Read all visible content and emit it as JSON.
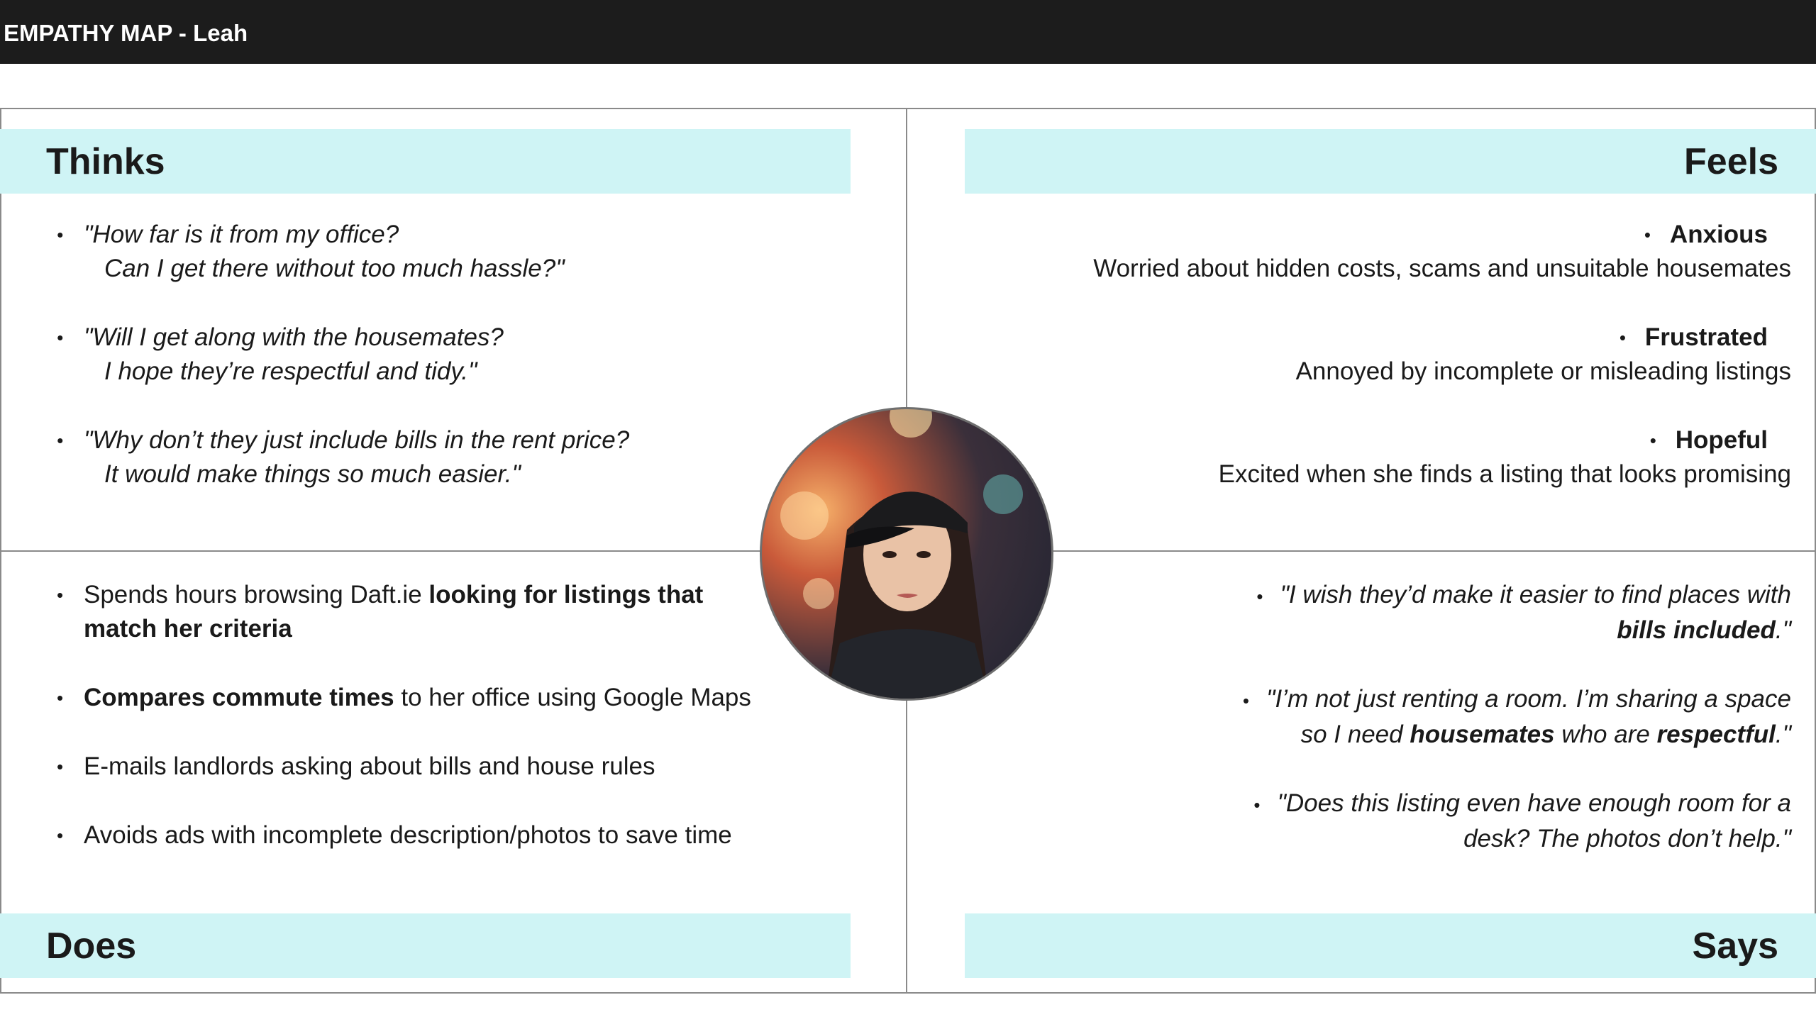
{
  "header": {
    "title": "EMPATHY MAP - Leah"
  },
  "quadrants": {
    "thinks": {
      "title": "Thinks",
      "items": [
        {
          "line1": "\"How far is it from my office?",
          "line2": "Can I get there without too much hassle?\""
        },
        {
          "line1": "\"Will I get along with the housemates?",
          "line2": "I hope they’re respectful and tidy.\""
        },
        {
          "line1": "\"Why don’t they just include bills in the rent price?",
          "line2": "It would make things so much easier.\""
        }
      ]
    },
    "feels": {
      "title": "Feels",
      "items": [
        {
          "emotion": "Anxious",
          "description": "Worried about hidden costs, scams and unsuitable housemates"
        },
        {
          "emotion": "Frustrated",
          "description": "Annoyed by incomplete or misleading listings"
        },
        {
          "emotion": "Hopeful",
          "description": "Excited when she finds a listing that looks promising"
        }
      ]
    },
    "does": {
      "title": "Does",
      "items": [
        {
          "pre": "Spends hours browsing Daft.ie ",
          "bold": "looking for listings that match her criteria",
          "post": ""
        },
        {
          "pre": "",
          "bold": "Compares commute times",
          "post": " to her office using Google Maps"
        },
        {
          "pre": "E-mails landlords asking about bills and house rules",
          "bold": "",
          "post": ""
        },
        {
          "pre": "Avoids ads with incomplete description/photos to save time",
          "bold": "",
          "post": ""
        }
      ]
    },
    "says": {
      "title": "Says",
      "items": [
        {
          "line1": "\"I wish they’d make it easier to find places with",
          "line2_bold": "bills included",
          "line2_post": ".\""
        },
        {
          "line1": "\"I’m not just renting a room. I’m sharing a space",
          "line2_pre": "so I need ",
          "line2_bold1": "housemates",
          "line2_mid": " who are ",
          "line2_bold2": "respectful",
          "line2_post": ".\""
        },
        {
          "line1": "\"Does this listing even have enough room for a",
          "line2_pre": "desk? The photos don’t help.\""
        }
      ]
    }
  },
  "avatar": {
    "alt": "Leah"
  },
  "colors": {
    "topbar": "#1c1c1c",
    "header_bg": "#cff4f5",
    "border": "#8a8a8a"
  }
}
